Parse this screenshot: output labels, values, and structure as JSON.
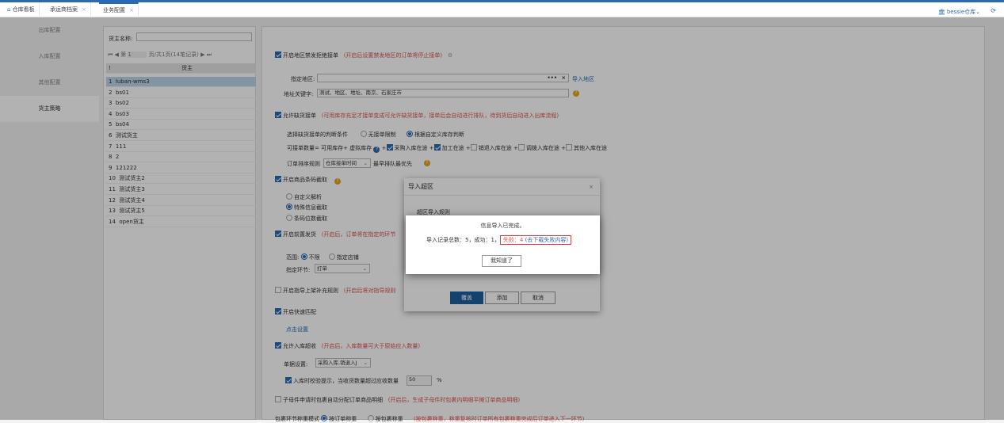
{
  "tabs": [
    {
      "label": "仓库看板",
      "icon": "home-icon"
    },
    {
      "label": "承运商档案",
      "close": "×"
    },
    {
      "label": "业务配置",
      "close": "×"
    }
  ],
  "user": {
    "label": "bessie仓库",
    "caret": "⌄"
  },
  "sidebar": {
    "items": [
      "出库配置",
      "入库配置",
      "其他配置",
      "货主策略"
    ]
  },
  "owner_panel": {
    "search_label": "货主名称:",
    "search_value": "",
    "pager": {
      "first": "⏮",
      "prev": "◀",
      "page_prefix": "第",
      "page": "1",
      "page_suffix": "页/共1页(14笔记录)",
      "next": "▶",
      "last": "⏭"
    },
    "col_index": "!",
    "col_owner": "货主",
    "rows": [
      [
        "1",
        "luban-wms3"
      ],
      [
        "2",
        "bs01"
      ],
      [
        "3",
        "bs02"
      ],
      [
        "4",
        "bs03"
      ],
      [
        "5",
        "bs04"
      ],
      [
        "6",
        "测试货主"
      ],
      [
        "7",
        "111"
      ],
      [
        "8",
        "2"
      ],
      [
        "9",
        "121222"
      ],
      [
        "10",
        "测试货主2"
      ],
      [
        "11",
        "测试货主3"
      ],
      [
        "12",
        "测试货主4"
      ],
      [
        "13",
        "测试货主5"
      ],
      [
        "14",
        "open货主"
      ]
    ]
  },
  "settings": {
    "region_block": {
      "label": "开启地区禁发拒绝接单",
      "hint": "(开启后设置禁发地区的订单将停止接单)"
    },
    "region_field": {
      "label": "指定地区:",
      "value": "",
      "dots": "•••",
      "clear": "×",
      "import_link": "导入地区"
    },
    "address_keywords": {
      "label": "地址关键字:",
      "value": "测试、地区、地址、南京、石家庄市"
    },
    "allow_shortage": {
      "label": "允许缺货接单",
      "hint": "(可用库存充足才接单变成可允许缺货接单，接单后会自动进行排队，待到货后自动进入出库流程)"
    },
    "shortage_condition": {
      "label": "选择缺货接单的判断条件",
      "opt1": "无接单限制",
      "opt2": "根据自定义库存判断"
    },
    "qty_formula": {
      "label": "可接单数量= 可用库存+ 虚拟库存",
      "plus": "+",
      "items": [
        "采购入库在途",
        "加工在途",
        "销退入库在途",
        "调拨入库在途",
        "其他入库在途"
      ]
    },
    "order_sort": {
      "label": "订单排序规则",
      "value": "仓库接单时间",
      "suffix": "最早排队最优先"
    },
    "barcode_capture": {
      "label": "开启商品条码截取",
      "opts": [
        "自定义解析",
        "特殊信息截取",
        "条码位数截取"
      ]
    },
    "pre_ship": {
      "label": "开启前置发货",
      "hint": "(开启后，订单将在指定的环节"
    },
    "scope": {
      "label": "范围:",
      "opt1": "不限",
      "opt2": "指定店铺"
    },
    "step": {
      "label": "指定环节:",
      "value": "打单"
    },
    "guide_shelf": {
      "label": "开启指导上架补充规则",
      "hint": "(开启后将对指导规则"
    },
    "express_match": {
      "label": "开启快速匹配",
      "link": "点击设置"
    },
    "over_receive": {
      "label": "允许入库超收",
      "hint": "(开启后，入库数量可大于原始应入数量)"
    },
    "doc_setting": {
      "label": "单据设置:",
      "value": "采购入库,销退入J"
    },
    "check_tip": {
      "label": "入库时校验提示，当收货数量超过应收数量",
      "value": "50",
      "unit": "%"
    },
    "child_parcel": {
      "label": "子母件申请时包裹自动分配订单商品明细",
      "hint": "(开启后，生成子母件时包裹内明细平摊订单商品明细)"
    },
    "weigh_mode": {
      "label": "包裹环节称重模式",
      "opt1": "按订单称重",
      "opt2": "按包裹称重",
      "hint": "(按包裹称重，称重复核时订单所有包裹称重完成后订单进入下一环节)"
    }
  },
  "dialog": {
    "title": "导入超区",
    "close": "×",
    "rule_label": "超区导入规则",
    "buttons": {
      "overwrite": "覆盖",
      "add": "添加",
      "cancel": "取消"
    }
  },
  "alert": {
    "title": "信息导入已完成。",
    "summary": "导入记录总数：5，成功：1，",
    "fail_label": "失败：4",
    "fail_link": "(去下载失败内容)",
    "ok": "我知道了"
  },
  "colors": {
    "accent": "#2a6ab3",
    "warning": "#e8a21a",
    "danger": "#e0383e"
  }
}
